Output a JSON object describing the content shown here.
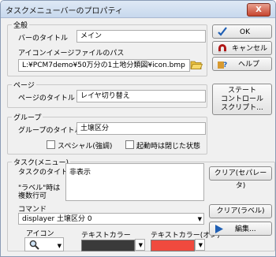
{
  "window": {
    "title": "タスクメニューバーのプロパティ",
    "close": "X"
  },
  "general": {
    "group_label": "全般",
    "bar_title_label": "バーのタイトル",
    "bar_title_value": "メイン",
    "icon_path_label": "アイコンイメージファイルのパス",
    "icon_path_value": "L:¥PCM7demo¥50万分の1土地分類図¥icon.bmp"
  },
  "buttons": {
    "ok": "OK",
    "cancel": "キャンセル",
    "help": "ヘルプ",
    "state_control_script": [
      "ステート",
      "コントロール",
      "スクリプト..."
    ],
    "clear_separator": "クリア(セパレータ)",
    "clear_label": "クリア(ラベル)",
    "edit": "編集..."
  },
  "page": {
    "group_label": "ページ",
    "title_label": "ページのタイトル",
    "title_value": "レイヤ切り替え"
  },
  "group": {
    "group_label": "グループ",
    "title_label": "グループのタイトル",
    "title_value": "土壌区分",
    "special_checkbox": "スペシャル(強調)",
    "closed_on_start_checkbox": "起動時は閉じた状態"
  },
  "task": {
    "group_label": "タスク(メニュー)",
    "title_label": "タスクのタイトル",
    "title_value": "非表示",
    "label_note": [
      "\"ラベル\"時は",
      "複数行可"
    ],
    "command_label": "コマンド",
    "command_value": "displayer 土壌区分 0",
    "icon_label": "アイコン",
    "text_color_label": "テキストカラー",
    "text_color_on_label": "テキストカラー(オン)",
    "text_color": "#3a3a3a",
    "text_color_on": "#f04a3e"
  },
  "colors": {
    "accent_blue": "#1f5fb4",
    "cancel_red": "#b01818"
  }
}
